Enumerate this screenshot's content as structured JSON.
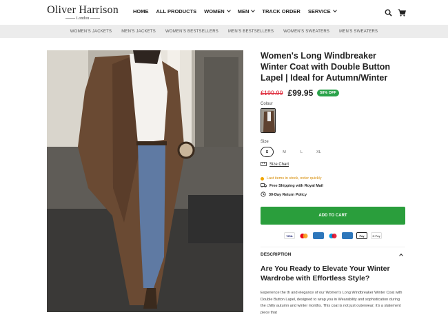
{
  "brand": {
    "name": "Oliver Harrison",
    "location": "London"
  },
  "nav": {
    "items": [
      {
        "label": "HOME",
        "dropdown": false
      },
      {
        "label": "ALL PRODUCTS",
        "dropdown": false
      },
      {
        "label": "WOMEN",
        "dropdown": true
      },
      {
        "label": "MEN",
        "dropdown": true
      },
      {
        "label": "TRACK ORDER",
        "dropdown": false
      },
      {
        "label": "SERVICE",
        "dropdown": true
      }
    ]
  },
  "subnav": {
    "items": [
      "WOMEN'S JACKETS",
      "MEN'S JACKETS",
      "WOMEN'S BESTSELLERS",
      "MEN'S BESTSELLERS",
      "WOMEN'S SWEATERS",
      "MEN'S SWEATERS"
    ]
  },
  "product": {
    "title": "Women's Long Windbreaker Winter Coat with Double Button Lapel | Ideal for Autumn/Winter",
    "old_price": "£199.99",
    "new_price": "£99.95",
    "discount_badge": "50% OFF",
    "colour_label": "Colour",
    "size_label": "Size",
    "sizes": [
      "S",
      "M",
      "L",
      "XL"
    ],
    "selected_size": "S",
    "size_chart": "Size Chart",
    "stock_note": "Last items in stock, order quickly",
    "shipping_note": "Free Shipping with Royal Mail",
    "return_note": "30-Day Return Policy",
    "add_to_cart": "ADD TO CART",
    "payments": [
      "VISA",
      "MC",
      "AMEX",
      "MAESTRO",
      "AMEX",
      "Apple Pay",
      "G Pay"
    ]
  },
  "description": {
    "heading": "DESCRIPTION",
    "title": "Are You Ready to Elevate Your Winter Wardrobe with Effortless Style?",
    "body": "Experience the th and elegance of our Women's Long Windbreaker Winter Coat with Double Button Lapel, designed to wrap you in Wearability and sophistication during the chilly autumn and winter months. This coat is not just outerwear; it's a statement piece that"
  },
  "colors": {
    "accent_green": "#2a9e3c",
    "sale_red": "#d22233",
    "stock_orange": "#d68a00"
  }
}
